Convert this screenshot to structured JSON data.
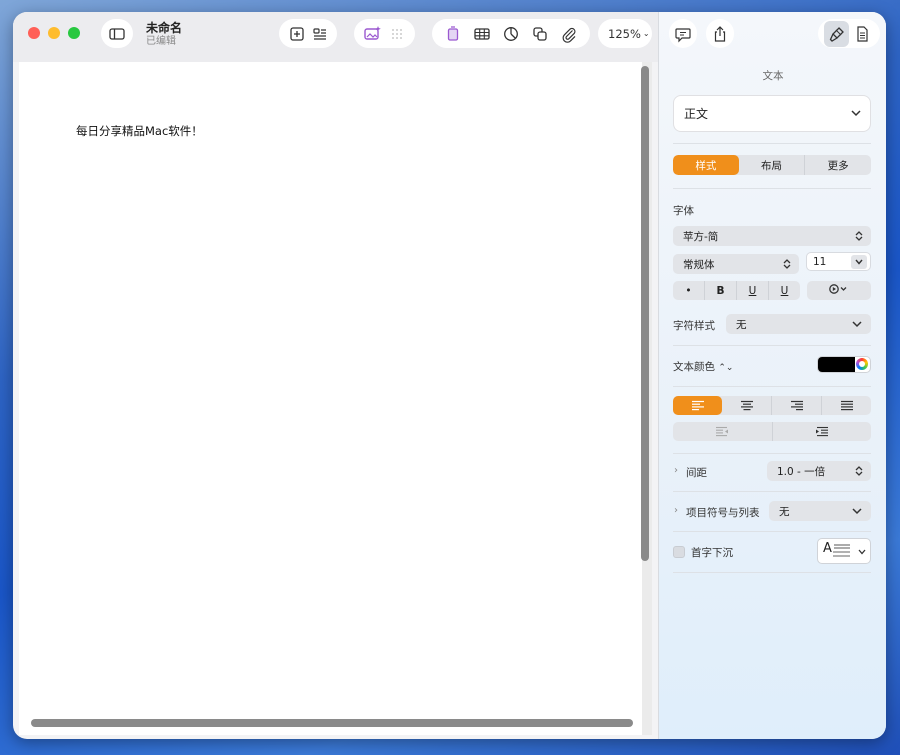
{
  "window": {
    "title": "未命名",
    "subtitle": "已编辑"
  },
  "toolbar": {
    "zoom": "125%",
    "icons": [
      "sidebar-icon",
      "add-page-icon",
      "text-box-icon",
      "image-playground-icon",
      "grid-icon",
      "text-insert-icon",
      "table-icon",
      "chart-icon",
      "shape-icon",
      "attachment-icon",
      "comment-icon",
      "share-icon",
      "format-brush-icon",
      "document-icon"
    ]
  },
  "document": {
    "body_text": "每日分享精品Mac软件！"
  },
  "sidebar": {
    "heading": "文本",
    "paragraph_style": "正文",
    "tabs": [
      {
        "label": "样式",
        "active": true
      },
      {
        "label": "布局",
        "active": false
      },
      {
        "label": "更多",
        "active": false
      }
    ],
    "font_label": "字体",
    "font_family": "苹方-简",
    "font_weight": "常规体",
    "font_size": "11",
    "style_buttons": [
      "•",
      "B",
      "U",
      "U"
    ],
    "char_style_label": "字符样式",
    "char_style_value": "无",
    "text_color_label": "文本颜色",
    "text_color": "#000000",
    "accent_color": "#f08f1b",
    "spacing_label": "间距",
    "spacing_value": "1.0 - 一倍",
    "bullets_label": "项目符号与列表",
    "bullets_value": "无",
    "dropcap_label": "首字下沉",
    "dropcap_preview": "A"
  }
}
